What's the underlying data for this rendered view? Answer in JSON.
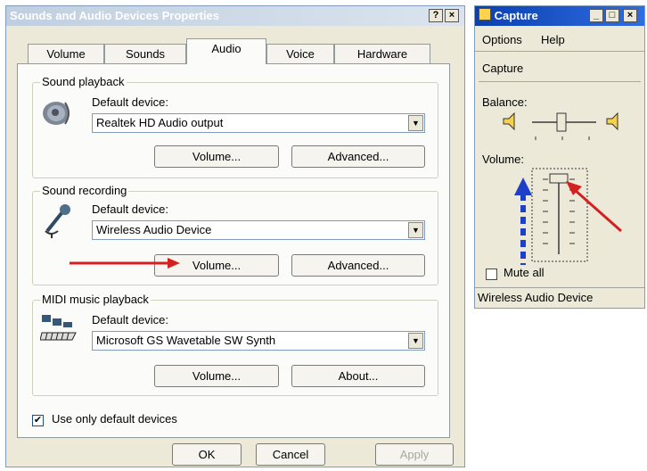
{
  "props_window": {
    "title": "Sounds and Audio Devices Properties",
    "help_btn": "?",
    "close_btn": "×",
    "tabs": [
      "Volume",
      "Sounds",
      "Audio",
      "Voice",
      "Hardware"
    ],
    "active_tab": "Audio",
    "sound_playback": {
      "group_label": "Sound playback",
      "default_device_label": "Default device:",
      "device_value": "Realtek HD Audio output",
      "volume_btn": "Volume...",
      "advanced_btn": "Advanced..."
    },
    "sound_recording": {
      "group_label": "Sound recording",
      "default_device_label": "Default device:",
      "device_value": "Wireless Audio Device",
      "volume_btn": "Volume...",
      "advanced_btn": "Advanced..."
    },
    "midi_playback": {
      "group_label": "MIDI music playback",
      "default_device_label": "Default device:",
      "device_value": "Microsoft GS Wavetable SW Synth",
      "volume_btn": "Volume...",
      "about_btn": "About..."
    },
    "use_only_default_label": "Use only default devices",
    "use_only_default_checked": true,
    "ok_btn": "OK",
    "cancel_btn": "Cancel",
    "apply_btn": "Apply"
  },
  "capture_window": {
    "title": "Capture",
    "menu": [
      "Options",
      "Help"
    ],
    "section_title": "Capture",
    "balance_label": "Balance:",
    "volume_label": "Volume:",
    "volume_level": 1.0,
    "mute_label": "Mute all",
    "mute_checked": false,
    "status": "Wireless Audio Device"
  },
  "colors": {
    "annotation_red": "#d42020",
    "annotation_blue": "#1e3fc8"
  }
}
